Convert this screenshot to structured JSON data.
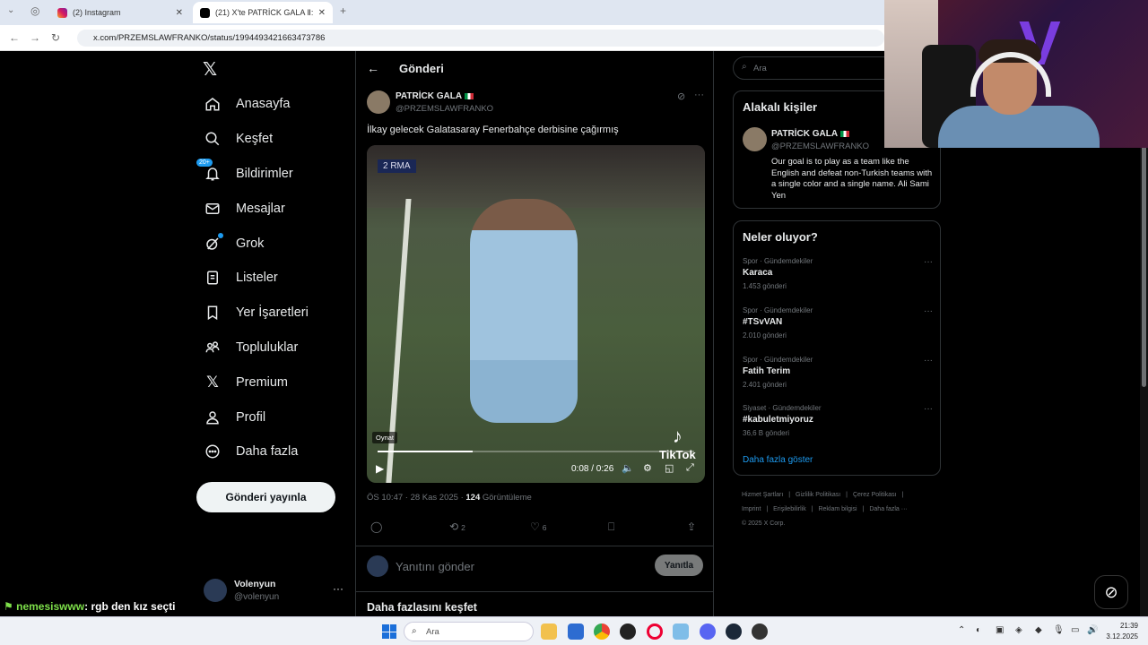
{
  "browser": {
    "tabs": [
      {
        "label": "(2) Instagram",
        "active": false
      },
      {
        "label": "(21) X'te PATRİCK GALA Ⅱ: \"İlka",
        "active": true
      }
    ],
    "url": "x.com/PRZEMSLAWFRANKO/status/1994493421663473786"
  },
  "sidebar": {
    "items": [
      {
        "label": "Anasayfa",
        "icon": "home-icon"
      },
      {
        "label": "Keşfet",
        "icon": "search-icon"
      },
      {
        "label": "Bildirimler",
        "icon": "bell-icon",
        "badge": "20+"
      },
      {
        "label": "Mesajlar",
        "icon": "mail-icon"
      },
      {
        "label": "Grok",
        "icon": "grok-icon"
      },
      {
        "label": "Listeler",
        "icon": "list-icon"
      },
      {
        "label": "Yer İşaretleri",
        "icon": "bookmark-icon"
      },
      {
        "label": "Topluluklar",
        "icon": "communities-icon"
      },
      {
        "label": "Premium",
        "icon": "x-icon"
      },
      {
        "label": "Profil",
        "icon": "user-icon"
      },
      {
        "label": "Daha fazla",
        "icon": "more-circle-icon"
      }
    ],
    "post_button": "Gönderi yayınla",
    "account": {
      "name": "Volenyun",
      "handle": "@volenyun"
    }
  },
  "chat_overlay": {
    "user": "nemesiswww",
    "message": ": rgb den kız seçti"
  },
  "main": {
    "header_title": "Gönderi",
    "post": {
      "author_name": "PATRİCK GALA",
      "author_handle": "@PRZEMSLAWFRANKO",
      "text": "İlkay gelecek Galatasaray Fenerbahçe derbisine çağırmış",
      "video": {
        "scorebug": "2  RMA",
        "tooltip": "Oynat",
        "watermark": "TikTok",
        "time": "0:08 / 0:26",
        "progress": 0.3
      },
      "time": "ÖS 10:47 · 28 Kas 2025 · ",
      "views": "124",
      "views_label": " Görüntüleme",
      "retweets": "2",
      "likes": "6"
    },
    "reply_placeholder": "Yanıtını gönder",
    "reply_button": "Yanıtla",
    "explore_title": "Daha fazlasını keşfet"
  },
  "right": {
    "search_placeholder": "Ara",
    "related": {
      "title": "Alakalı kişiler",
      "name": "PATRİCK GALA",
      "handle": "@PRZEMSLAWFRANKO",
      "bio": "Our goal is to play as a team like the English and defeat non-Turkish teams with a single color and a single name. Ali Sami Yen"
    },
    "trends": {
      "title": "Neler oluyor?",
      "items": [
        {
          "category": "Spor · Gündemdekiler",
          "title": "Karaca",
          "count": "1.453 gönderi"
        },
        {
          "category": "Spor · Gündemdekiler",
          "title": "#TSvVAN",
          "count": "2.010 gönderi"
        },
        {
          "category": "Spor · Gündemdekiler",
          "title": "Fatih Terim",
          "count": "2.401 gönderi"
        },
        {
          "category": "Siyaset · Gündemdekiler",
          "title": "#kabuletmiyoruz",
          "count": "36,6 B gönderi"
        }
      ],
      "show_more": "Daha fazla göster"
    },
    "footer": [
      "Hizmet Şartları",
      "|",
      "Gizlilik Politikası",
      "|",
      "Çerez Politikası",
      "|",
      "Imprint",
      "|",
      "Erişilebilirlik",
      "|",
      "Reklam bilgisi",
      "|",
      "Daha fazla ···",
      "© 2025 X Corp."
    ]
  },
  "taskbar": {
    "search_placeholder": "Ara",
    "time": "21:39",
    "date": "3.12.2025"
  }
}
